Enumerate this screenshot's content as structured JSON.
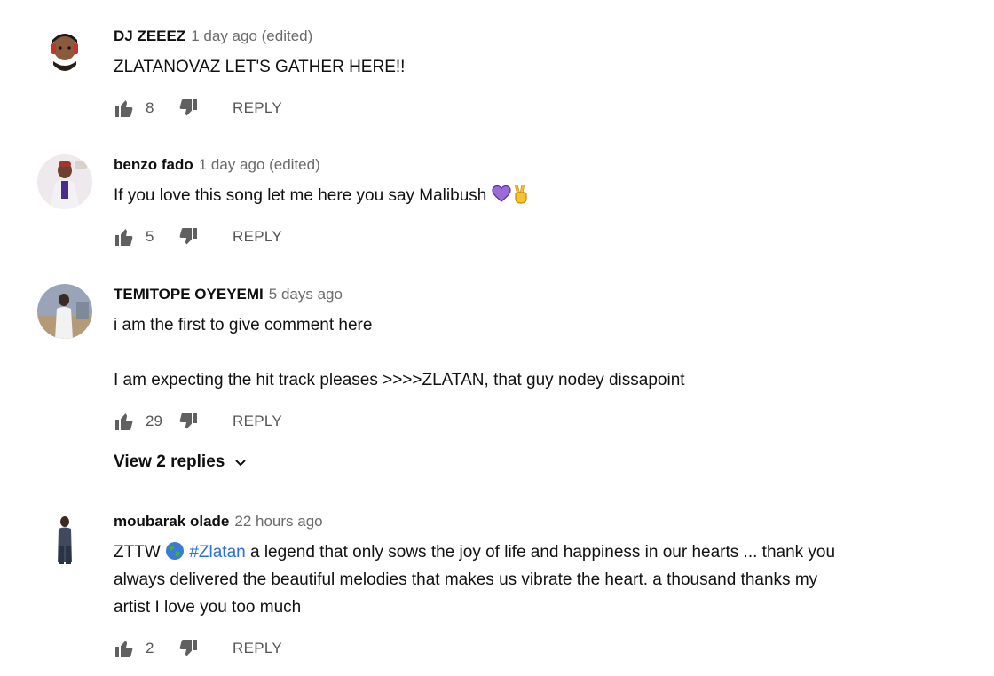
{
  "comments": [
    {
      "author": "DJ ZEEEZ",
      "time": "1 day ago (edited)",
      "lines": [
        "ZLATANOVAZ LET'S GATHER HERE!!"
      ],
      "likes": "8",
      "reply_label": "REPLY"
    },
    {
      "author": "benzo fado",
      "time": "1 day ago (edited)",
      "lines": [
        "If you love this song let me here you say Malibush"
      ],
      "emojis": [
        "purple-heart-icon",
        "victory-hand-icon"
      ],
      "likes": "5",
      "reply_label": "REPLY"
    },
    {
      "author": "TEMITOPE OYEYEMI",
      "time": "5 days ago",
      "lines": [
        "i am the first to give comment here",
        "I am expecting the hit track pleases >>>>ZLATAN, that guy nodey dissapoint"
      ],
      "likes": "29",
      "reply_label": "REPLY",
      "view_replies": "View 2 replies"
    },
    {
      "author": "moubarak olade",
      "time": "22 hours ago",
      "prefix": "ZTTW",
      "hashtag": "#Zlatan",
      "line1_rest": "a legend that only sows the joy of life and happiness in our hearts ... thank you",
      "line2": "always delivered the beautiful melodies that makes us vibrate the heart.  a thousand thanks my",
      "line3": "artist I love you too much",
      "likes": "2",
      "reply_label": "REPLY"
    }
  ],
  "colors": {
    "author": "#0f0f0f",
    "meta": "#6a6a6a",
    "hashtag": "#2a6fd6",
    "action": "#555555"
  }
}
